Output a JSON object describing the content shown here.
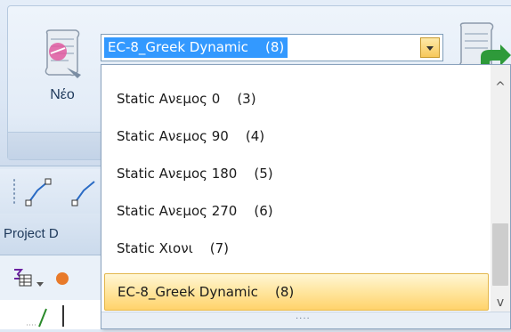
{
  "ribbon": {
    "new_button_label": "Νέο"
  },
  "combo": {
    "selected_value": "EC-8_Greek Dynamic    (8)"
  },
  "panel": {
    "title": "Project D"
  },
  "dropdown": {
    "items": [
      {
        "label": "Static Ανεμος 0    (3)"
      },
      {
        "label": "Static Ανεμος 90    (4)"
      },
      {
        "label": "Static Ανεμος 180    (5)"
      },
      {
        "label": "Static Ανεμος 270    (6)"
      },
      {
        "label": "Static Χιονι    (7)"
      },
      {
        "label": "EC-8_Greek Dynamic    (8)"
      }
    ],
    "selected_index": 5,
    "scroll_up_glyph": "^",
    "scroll_down_glyph": "v",
    "grip_glyph": "····"
  },
  "icons": {
    "new": "scroll-new-icon",
    "load_combo": "scroll-green-arrow-icon",
    "polyline": "polyline-tool-icon",
    "sum_table": "sum-table-icon",
    "tree_branch": "tree-branch-icon"
  }
}
